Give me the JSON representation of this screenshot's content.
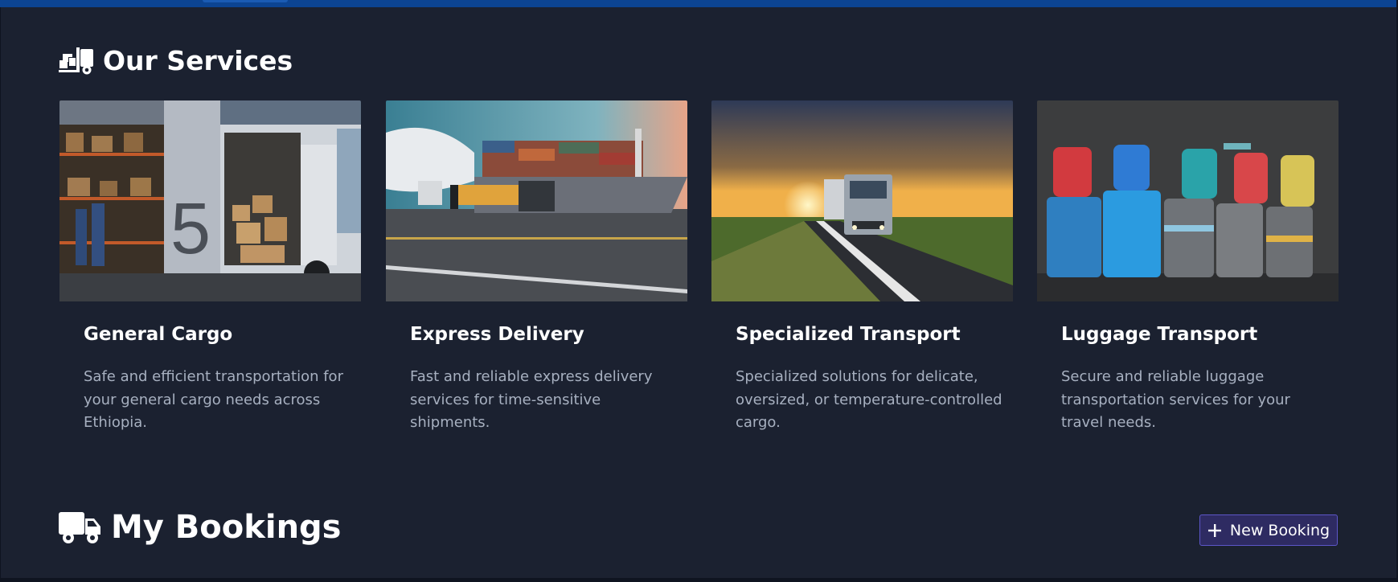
{
  "services_section": {
    "title": "Our Services",
    "icon": "hand-truck-boxes-icon",
    "cards": [
      {
        "title": "General Cargo",
        "image": "delivery-van-warehouse-image",
        "description_lines": [
          "Safe and efficient transportation for",
          "your general cargo needs across",
          "Ethiopia."
        ]
      },
      {
        "title": "Express Delivery",
        "image": "airplane-cargo-ship-truck-image",
        "description_lines": [
          "Fast and reliable express delivery",
          "services for time-sensitive",
          "shipments."
        ]
      },
      {
        "title": "Specialized Transport",
        "image": "truck-sunset-highway-image",
        "description_lines": [
          "Specialized solutions for delicate,",
          "oversized, or temperature-controlled",
          "cargo."
        ]
      },
      {
        "title": "Luggage Transport",
        "image": "suitcases-backpacks-image",
        "description_lines": [
          "Secure and reliable luggage",
          "transportation services for your",
          "travel needs."
        ]
      }
    ]
  },
  "bookings_section": {
    "title": "My Bookings",
    "icon": "truck-icon",
    "new_booking_label": "New Booking",
    "new_booking_icon": "plus-icon"
  },
  "colors": {
    "background": "#1b2130",
    "topbar": "#0c4492",
    "heading_text": "#ffffff",
    "body_text": "#a7b0c0",
    "button_bg": "#2e2b62",
    "button_border": "#5c56c8"
  }
}
